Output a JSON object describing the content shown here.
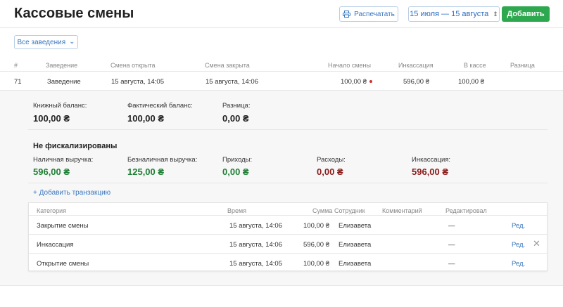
{
  "header": {
    "title": "Кассовые смены",
    "print_label": "Распечатать",
    "date_range": "15 июля — 15 августа",
    "date_range_arrows": "⇕",
    "add_label": "Добавить"
  },
  "filter": {
    "label": "Все заведения",
    "arrow": "⌄"
  },
  "table": {
    "headers": {
      "num": "#",
      "venue": "Заведение",
      "opened": "Смена открыта",
      "closed": "Смена закрыта",
      "start": "Начало смены",
      "collection": "Инкассация",
      "in_cash": "В кассе",
      "diff": "Разница"
    },
    "row": {
      "num": "71",
      "venue": "Заведение",
      "opened": "15 августа, 14:05",
      "closed": "15 августа, 14:06",
      "start": "100,00 ₴",
      "collection": "596,00 ₴",
      "in_cash": "100,00 ₴",
      "diff": ""
    }
  },
  "detail": {
    "book_balance_label": "Книжный баланс:",
    "book_balance": "100,00 ₴",
    "actual_balance_label": "Фактический баланс:",
    "actual_balance": "100,00 ₴",
    "diff_label": "Разница:",
    "diff": "0,00 ₴",
    "section_title": "Не фискализированы",
    "cash_rev_label": "Наличная выручка:",
    "cash_rev": "596,00 ₴",
    "noncash_rev_label": "Безналичная выручка:",
    "noncash_rev": "125,00 ₴",
    "income_label": "Приходы:",
    "income": "0,00 ₴",
    "expense_label": "Расходы:",
    "expense": "0,00 ₴",
    "collection_label": "Инкассация:",
    "collection": "596,00 ₴",
    "add_tx": "+ Добавить транзакцию"
  },
  "transactions": {
    "headers": {
      "category": "Категория",
      "time": "Время",
      "sum": "Сумма",
      "employee": "Сотрудник",
      "comment": "Комментарий",
      "edited": "Редактировал"
    },
    "rows": [
      {
        "category": "Закрытие смены",
        "time": "15 августа, 14:06",
        "sum": "100,00 ₴",
        "employee": "Елизавета",
        "edited": "—",
        "edit": "Ред."
      },
      {
        "category": "Инкассация",
        "time": "15 августа, 14:06",
        "sum": "596,00 ₴",
        "employee": "Елизавета",
        "edited": "—",
        "edit": "Ред.",
        "delete": "✕"
      },
      {
        "category": "Открытие смены",
        "time": "15 августа, 14:05",
        "sum": "100,00 ₴",
        "employee": "Елизавета",
        "edited": "—",
        "edit": "Ред."
      }
    ]
  },
  "colors": {
    "accent": "#3a78c0",
    "add_button": "#2ea84f",
    "positive": "#1e7e34",
    "negative": "#8b1a1a"
  }
}
